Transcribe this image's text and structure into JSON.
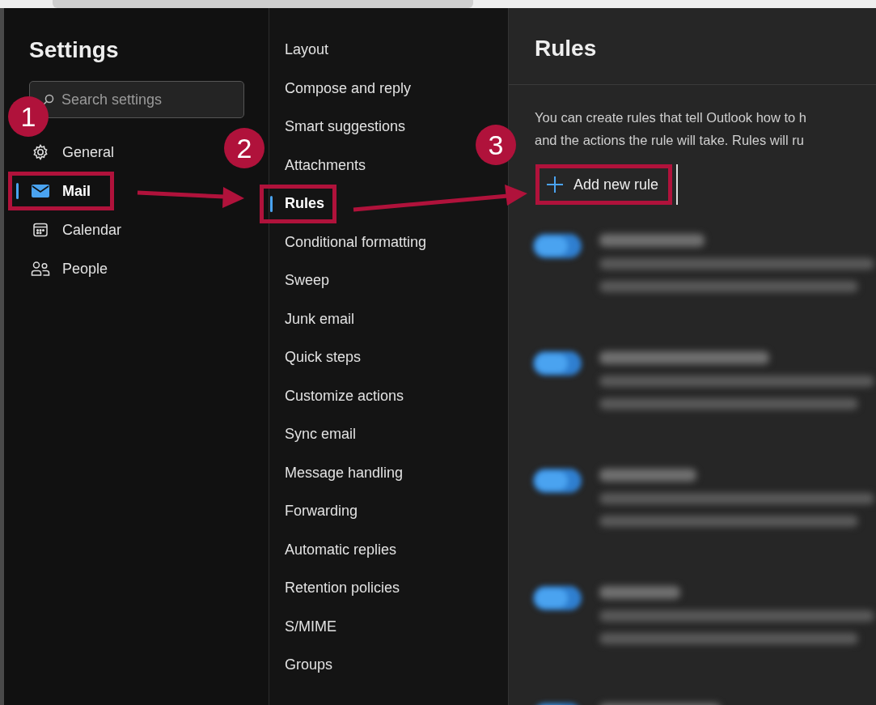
{
  "settings": {
    "title": "Settings",
    "search": {
      "placeholder": "Search settings"
    },
    "nav": [
      {
        "label": "General",
        "selected": false,
        "highlighted": false
      },
      {
        "label": "Mail",
        "selected": true,
        "highlighted": true
      },
      {
        "label": "Calendar",
        "selected": false,
        "highlighted": false
      },
      {
        "label": "People",
        "selected": false,
        "highlighted": false
      }
    ]
  },
  "mail_menu": [
    {
      "label": "Layout",
      "selected": false,
      "highlighted": false
    },
    {
      "label": "Compose and reply",
      "selected": false,
      "highlighted": false
    },
    {
      "label": "Smart suggestions",
      "selected": false,
      "highlighted": false
    },
    {
      "label": "Attachments",
      "selected": false,
      "highlighted": false
    },
    {
      "label": "Rules",
      "selected": true,
      "highlighted": true
    },
    {
      "label": "Conditional formatting",
      "selected": false,
      "highlighted": false
    },
    {
      "label": "Sweep",
      "selected": false,
      "highlighted": false
    },
    {
      "label": "Junk email",
      "selected": false,
      "highlighted": false
    },
    {
      "label": "Quick steps",
      "selected": false,
      "highlighted": false
    },
    {
      "label": "Customize actions",
      "selected": false,
      "highlighted": false
    },
    {
      "label": "Sync email",
      "selected": false,
      "highlighted": false
    },
    {
      "label": "Message handling",
      "selected": false,
      "highlighted": false
    },
    {
      "label": "Forwarding",
      "selected": false,
      "highlighted": false
    },
    {
      "label": "Automatic replies",
      "selected": false,
      "highlighted": false
    },
    {
      "label": "Retention policies",
      "selected": false,
      "highlighted": false
    },
    {
      "label": "S/MIME",
      "selected": false,
      "highlighted": false
    },
    {
      "label": "Groups",
      "selected": false,
      "highlighted": false
    }
  ],
  "pane": {
    "title": "Rules",
    "description_lines": [
      "You can create rules that tell Outlook how to h",
      "and the actions the rule will take. Rules will ru"
    ],
    "add_button": {
      "label": "Add new rule",
      "highlighted": true
    },
    "rules": [
      {
        "on": true
      },
      {
        "on": true
      },
      {
        "on": true
      },
      {
        "on": true
      },
      {
        "on": true
      }
    ]
  },
  "annotations": {
    "steps": [
      "1",
      "2",
      "3"
    ]
  }
}
